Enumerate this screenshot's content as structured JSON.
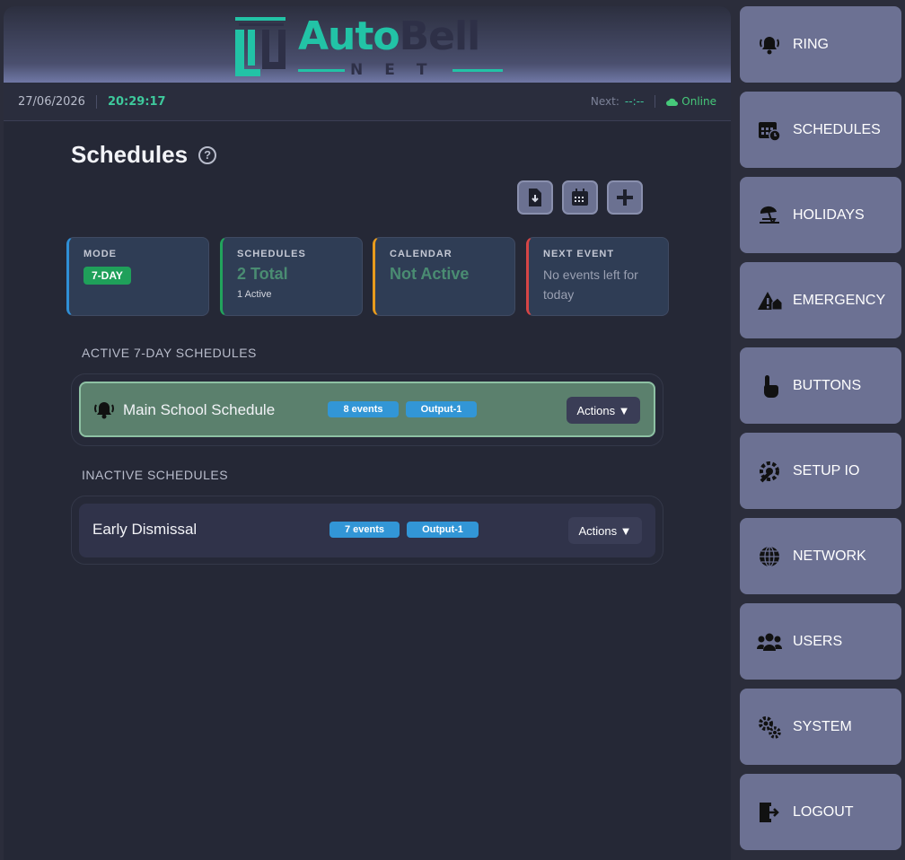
{
  "header": {
    "brand_auto": "Auto",
    "brand_bell": "Bell",
    "brand_net": "NET"
  },
  "status": {
    "date": "27/06/2026",
    "time": "20:29:17",
    "next_label": "Next:",
    "next_value": "--:--",
    "online": "Online"
  },
  "page": {
    "title": "Schedules",
    "help": "?"
  },
  "toolbar": {
    "import_icon": "file-import-icon",
    "calendar_icon": "calendar-icon",
    "add_icon": "plus-icon"
  },
  "cards": {
    "mode": {
      "label": "MODE",
      "value": "7-DAY"
    },
    "schedules": {
      "label": "SCHEDULES",
      "value": "2 Total",
      "sub": "1 Active"
    },
    "calendar": {
      "label": "CALENDAR",
      "value": "Not Active"
    },
    "next_event": {
      "label": "NEXT EVENT",
      "value": "No events left for today"
    },
    "colors": {
      "mode": "#2f8fd6",
      "schedules": "#22a35c",
      "calendar": "#e89b1d",
      "next_event": "#d64545"
    }
  },
  "active_section": {
    "title": "ACTIVE 7-DAY SCHEDULES",
    "rows": [
      {
        "name": "Main School Schedule",
        "events": "8 events",
        "output": "Output-1",
        "actions": "Actions ▼"
      }
    ]
  },
  "inactive_section": {
    "title": "INACTIVE SCHEDULES",
    "rows": [
      {
        "name": "Early Dismissal",
        "events": "7 events",
        "output": "Output-1",
        "actions": "Actions ▼"
      }
    ]
  },
  "sidebar": {
    "items": [
      {
        "label": "RING",
        "icon": "bell-ring-icon"
      },
      {
        "label": "SCHEDULES",
        "icon": "calendar-clock-icon"
      },
      {
        "label": "HOLIDAYS",
        "icon": "beach-umbrella-icon"
      },
      {
        "label": "EMERGENCY",
        "icon": "warning-house-icon"
      },
      {
        "label": "BUTTONS",
        "icon": "hand-pointer-icon"
      },
      {
        "label": "SETUP IO",
        "icon": "wrench-gear-icon"
      },
      {
        "label": "NETWORK",
        "icon": "globe-icon"
      },
      {
        "label": "USERS",
        "icon": "users-icon"
      },
      {
        "label": "SYSTEM",
        "icon": "gears-icon"
      },
      {
        "label": "LOGOUT",
        "icon": "logout-door-icon"
      }
    ]
  }
}
